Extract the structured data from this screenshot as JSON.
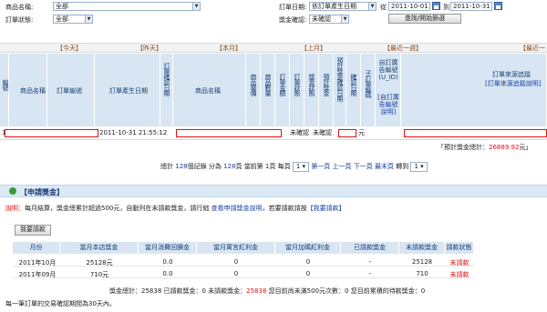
{
  "filters": {
    "product_name_label": "商品名稱:",
    "product_name_value": "全部",
    "order_date_label": "訂單日期:",
    "order_date_type": "依訂單產生日期",
    "date_from_label": "從",
    "date_from": "2011-10-01",
    "date_to_label": "到",
    "date_to": "2011-10-31",
    "order_status_label": "訂單狀態:",
    "order_status_value": "全部",
    "bonus_status_label": "獎金確認:",
    "bonus_status_value": "未確認",
    "search_button": "查詢/開始篩選"
  },
  "period_tabs": [
    "【今天】",
    "【昨天】",
    "【本月】",
    "【上月】",
    "【最近一週】",
    "【最近一"
  ],
  "table": {
    "headers": {
      "seq": "編號",
      "product_name": "商品名稱",
      "order_no": "訂單編號",
      "order_created": "訂單產生日期",
      "order_confirm_date": "訂單確認日期",
      "product_name2": "商品名稱",
      "unit_price": "商品單價",
      "qty": "商品數量",
      "order_amount": "訂單金額",
      "order_status": "訂單狀態",
      "bonus_status": "獎金狀態",
      "est_bonus": "預計獎金",
      "bonus_confirm": "預計獎金確認日期",
      "confirm_date2": "確認日期",
      "sub_id": "子訂單編碼",
      "ad_source": "自訂廣告編號(U_ID)",
      "ad_source_link": "[自訂廣告編號說明]",
      "source_track": "訂單來源追蹤",
      "source_track_link": "[訂單來源追蹤說明]"
    },
    "row": {
      "seq": "1",
      "created": "2011-10-31 21:55:12",
      "order_status": "未確認",
      "bonus_status": "未確認",
      "bonus_unit": "元"
    },
    "total_label": "「預計獎金總計：",
    "total_value": "26889.92",
    "total_unit": "元」"
  },
  "pager": {
    "total_prefix": "總計",
    "total_count": "128",
    "total_suffix": "個記錄",
    "pages_prefix": "分為",
    "pages_count": "128",
    "pages_suffix": "頁",
    "current_prefix": "當前第",
    "current_page": "1",
    "current_suffix": "頁",
    "per_page_prefix": "每頁",
    "per_page": "1",
    "first": "第一頁",
    "prev": "上一頁",
    "next": "下一頁",
    "last": "最末頁",
    "goto_label": "轉到",
    "goto_value": "1"
  },
  "bonus_section": {
    "title": "【申請獎金】",
    "note_label": "說明：",
    "note_text": "每月結算，獎金總累計超過500元，自動列在未請款獎金，請行絀",
    "note_link1": "查看申請獎金說明",
    "note_mid": "，若要請款請按",
    "note_link2": "【我要請款】",
    "request_button": "我要請款"
  },
  "monthly": {
    "headers": [
      "月份",
      "當月本店獎金",
      "當月消費回饋金",
      "當月寓言紅利金",
      "當月加碼紅利金",
      "已請款獎金",
      "未請款獎金",
      "請款狀態"
    ],
    "rows": [
      {
        "month": "2011年10月",
        "store": "25128元",
        "rebate": "0.0",
        "fable": "0",
        "extra": "0",
        "paid": "-",
        "unpaid": "25128",
        "status": "未請款"
      },
      {
        "month": "2011年09月",
        "store": "710元",
        "rebate": "0.0",
        "fable": "0",
        "extra": "0",
        "paid": "-",
        "unpaid": "710",
        "status": "未請款"
      }
    ],
    "summary": "獎金總計：25838   已請款獎金：0   未請款獎金：",
    "summary_unpaid": "25838",
    "summary_tail": "   您目前尚未滿500元次數：0   您目前累積的待款獎金：0",
    "footer": "每一筆訂單的交易確認期間為30天內。"
  },
  "colors": {
    "accent": "#d8e6f3",
    "link": "#1a3ea0",
    "warn": "#e01010",
    "tab": "#8a4a18"
  }
}
